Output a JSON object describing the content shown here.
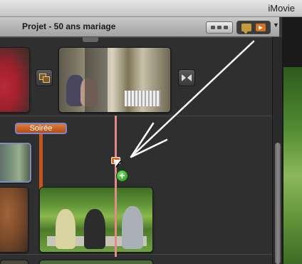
{
  "window": {
    "app_title": "iMovie"
  },
  "project": {
    "title": "Projet - 50 ans mariage"
  },
  "toolbar": {
    "view_button_icon": "thumbnail-grid-icon",
    "comment_marker_icon": "comment-marker-icon",
    "chapter_marker_icon": "chapter-marker-icon",
    "menu_icon": "triangle-down-icon",
    "menu_glyph": "▼"
  },
  "timeline": {
    "title_tag": "Soirée",
    "add_glyph": "+",
    "colors": {
      "title_tag": "#c0561b",
      "chapter_marker": "#e26b1f",
      "playhead": "#e48a8a",
      "add_badge": "#2f9a24"
    }
  }
}
